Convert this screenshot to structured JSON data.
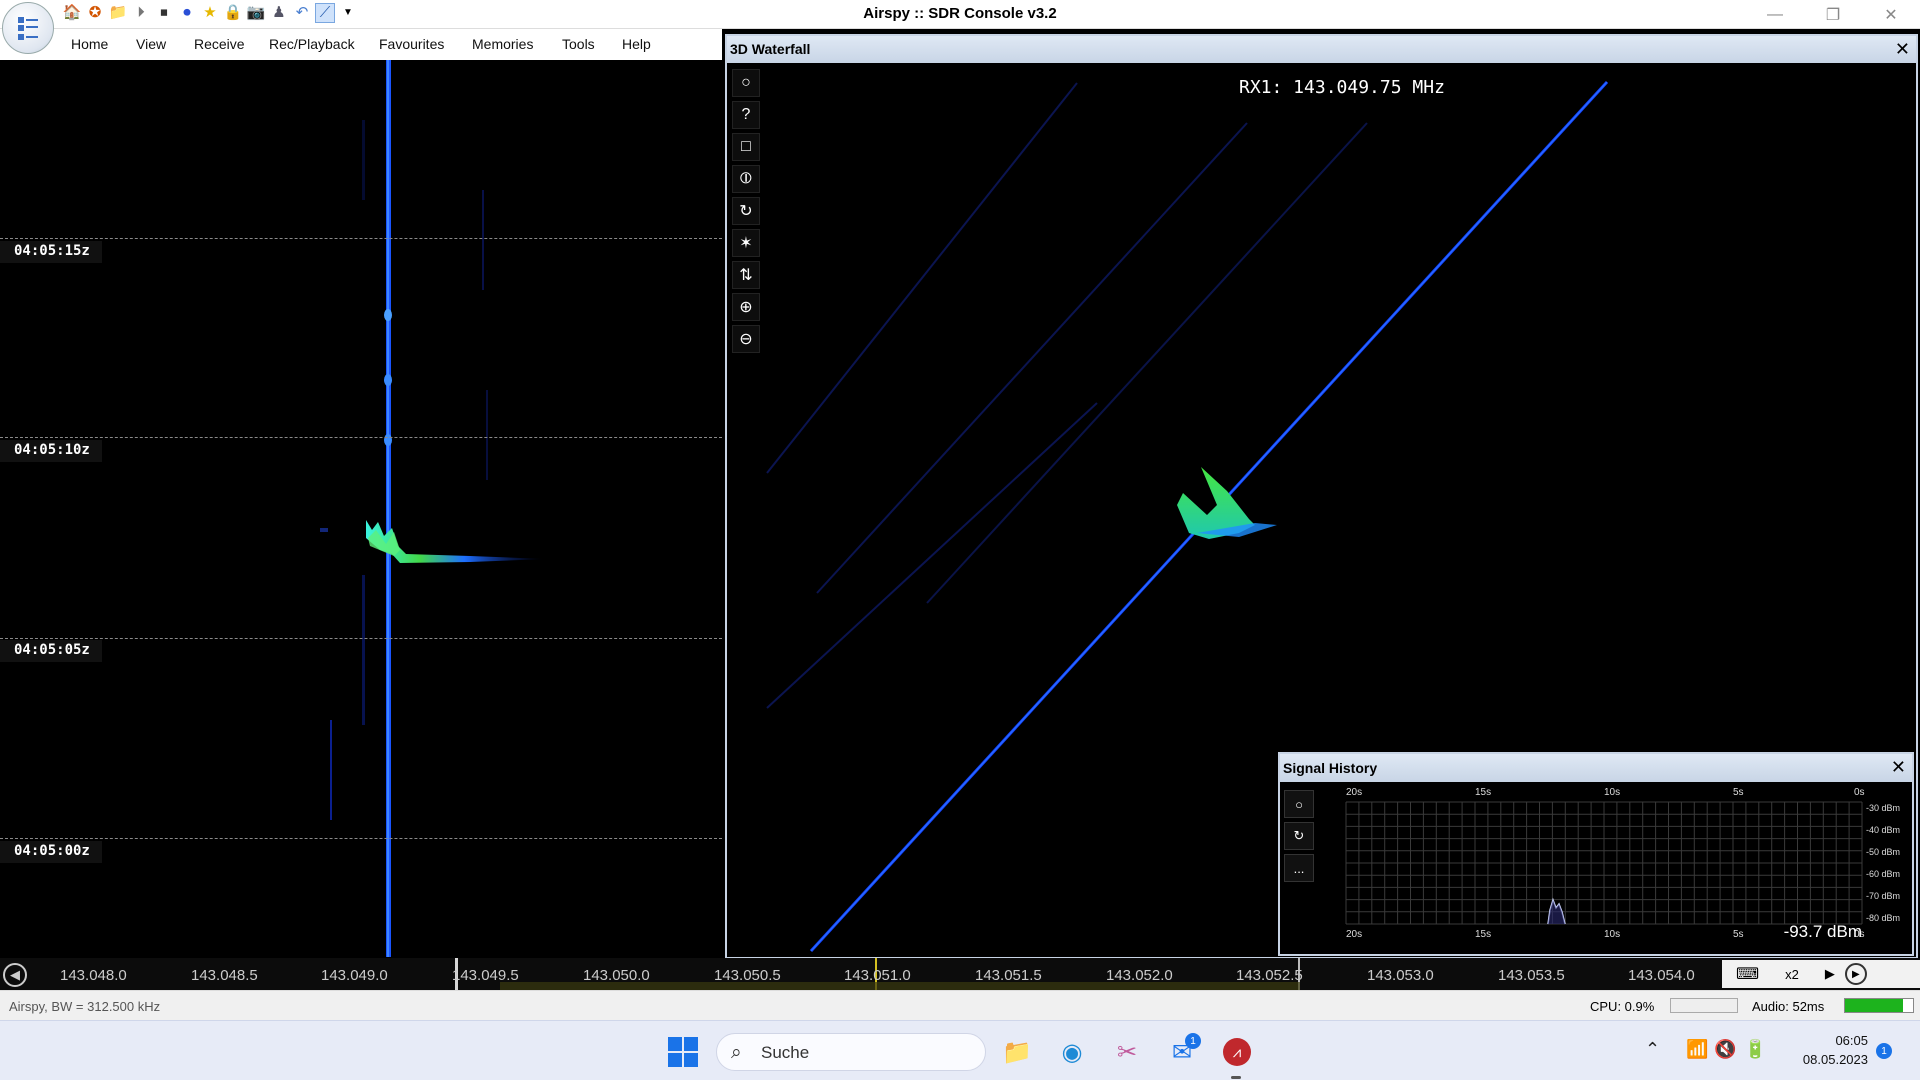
{
  "window": {
    "title": "Airspy :: SDR Console v3.2",
    "controls": [
      "—",
      "❐",
      "✕"
    ]
  },
  "quick_access": [
    "home-icon",
    "lifebuoy-icon",
    "folder-icon",
    "play-icon",
    "stop-icon",
    "record-icon",
    "favourite-star-icon",
    "lock-icon",
    "camera-icon",
    "user-icon",
    "undo-icon",
    "chart-icon",
    "dropdown-arrow-icon"
  ],
  "menu": [
    "Home",
    "View",
    "Receive",
    "Rec/Playback",
    "Favourites",
    "Memories",
    "Tools",
    "Help"
  ],
  "left_waterfall": {
    "time_labels": [
      "04:05:15z",
      "04:05:10z",
      "04:05:05z",
      "04:05:00z"
    ]
  },
  "waterfall3d": {
    "title": "3D Waterfall",
    "close": "✕",
    "rx_label": "RX1: 143.049.75 MHz",
    "toolbar": [
      "○",
      "?",
      "□",
      "⦶",
      "↻",
      "✶",
      "⇅",
      "⊕",
      "⊖"
    ]
  },
  "signal_history": {
    "title": "Signal History",
    "close": "✕",
    "toolbar": [
      "○",
      "↻",
      "..."
    ],
    "time_labels": [
      "20s",
      "15s",
      "10s",
      "5s",
      "0s"
    ],
    "dbm_labels": [
      "-30 dBm",
      "-40 dBm",
      "-50 dBm",
      "-60 dBm",
      "-70 dBm",
      "-80 dBm"
    ],
    "current_value": "-93.7 dBm"
  },
  "frequency_scale": {
    "labels": [
      "143.048.0",
      "143.048.5",
      "143.049.0",
      "143.049.5",
      "143.050.0",
      "143.050.5",
      "143.051.0",
      "143.051.5",
      "143.052.0",
      "143.052.5",
      "143.053.0",
      "143.053.5",
      "143.054.0"
    ],
    "zoom": "x2"
  },
  "status": {
    "left": "Airspy, BW = 312.500 kHz",
    "cpu": "CPU: 0.9%",
    "audio": "Audio: 52ms",
    "audio_level": 0.85,
    "audio_color": "#1db31d"
  },
  "taskbar": {
    "search_placeholder": "Suche",
    "mail_badge": "1",
    "notification_badge": "1",
    "time": "06:05",
    "date": "08.05.2023",
    "accent": "#1a73e8"
  }
}
